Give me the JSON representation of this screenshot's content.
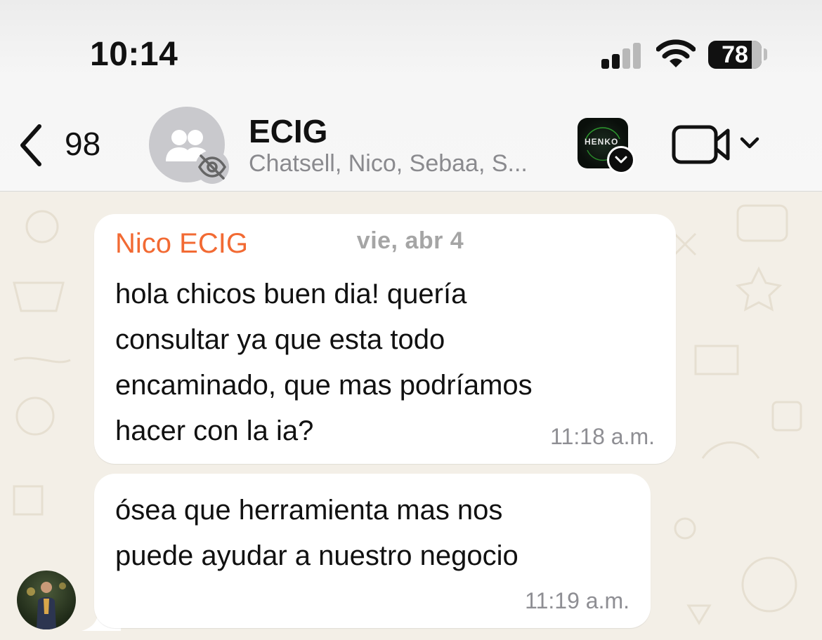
{
  "status_bar": {
    "time": "10:14",
    "battery": "78"
  },
  "header": {
    "back_count": "98",
    "title": "ECIG",
    "subtitle": "Chatsell, Nico, Sebaa, S...",
    "app_badge_text": "HENKO"
  },
  "chat": {
    "date_label": "vie, abr 4",
    "messages": [
      {
        "sender": "Nico ECIG",
        "lines": [
          "hola chicos buen dia! quería",
          "consultar ya que esta todo",
          "encaminado, que mas podríamos",
          "hacer con la ia?"
        ],
        "time": "11:18 a.m."
      },
      {
        "lines": [
          "ósea que herramienta mas nos",
          "puede ayudar a nuestro negocio"
        ],
        "time": "11:19 a.m."
      }
    ]
  },
  "colors": {
    "sender": "#f26a33",
    "background": "#f3efe7",
    "bubble": "#ffffff"
  }
}
